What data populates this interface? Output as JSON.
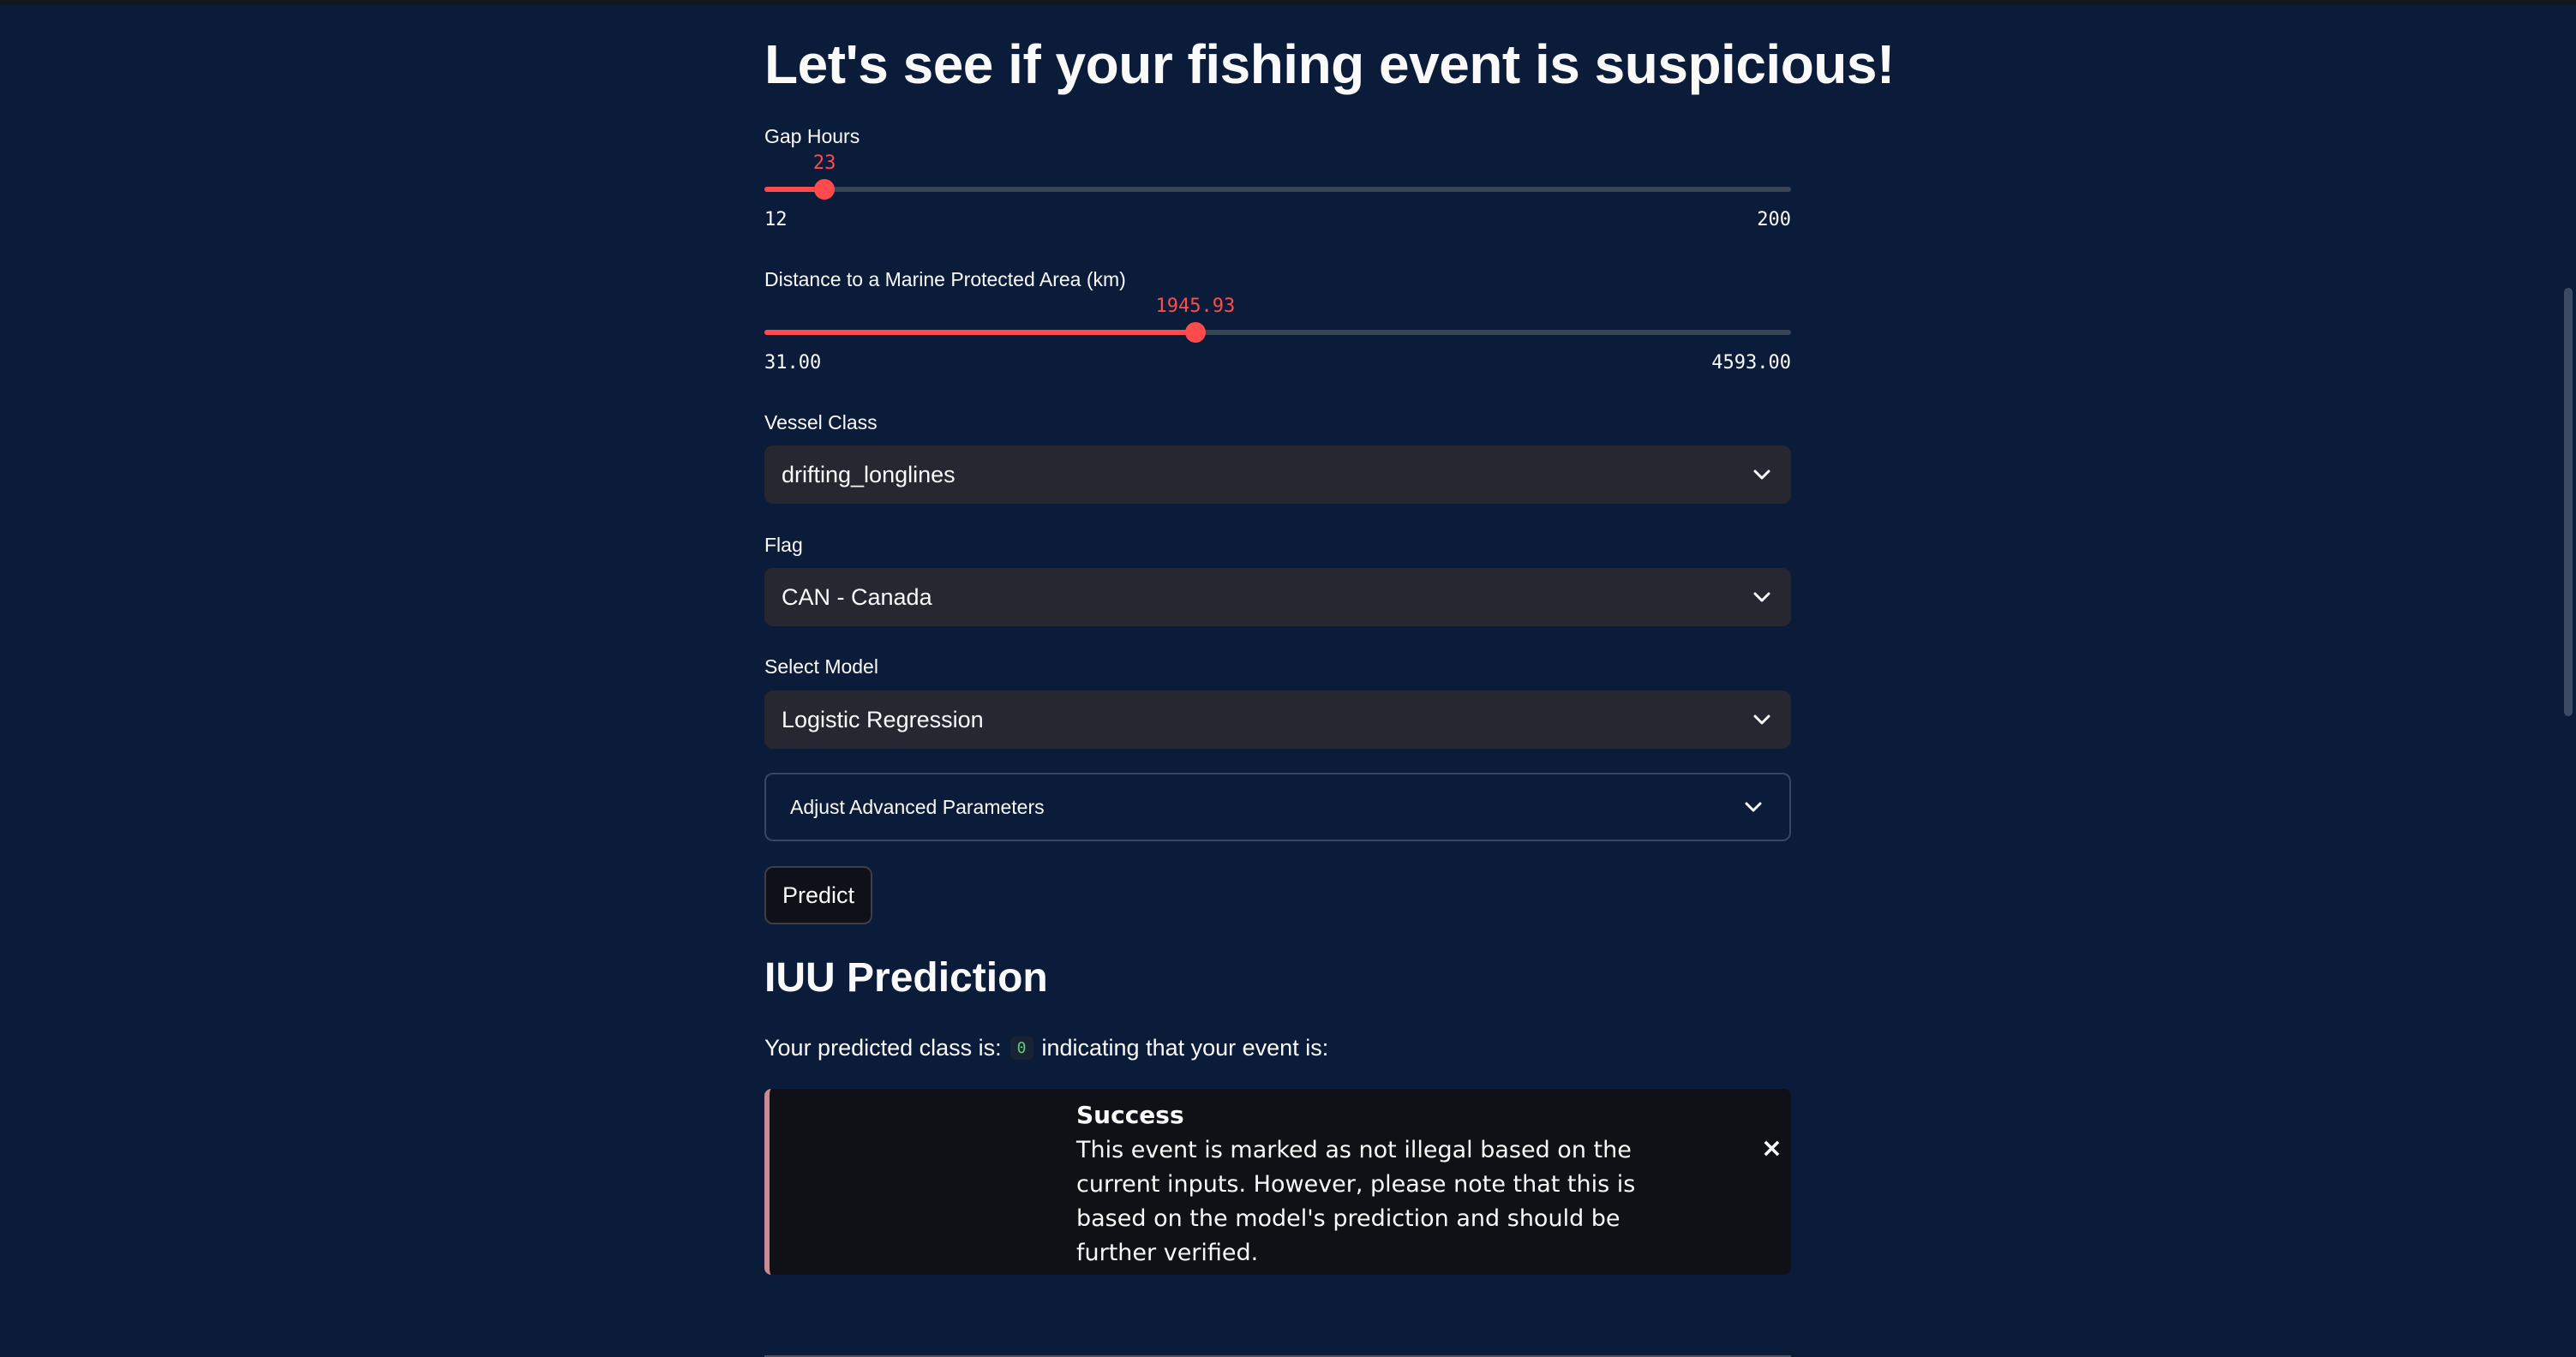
{
  "page": {
    "title": "Let's see if your fishing event is suspicious!"
  },
  "gap_hours": {
    "label": "Gap Hours",
    "value_text": "23",
    "value": 23,
    "min_text": "12",
    "max_text": "200",
    "min": 12,
    "max": 200
  },
  "distance_mpa": {
    "label": "Distance to a Marine Protected Area (km)",
    "value_text": "1945.93",
    "value": 1945.93,
    "min_text": "31.00",
    "max_text": "4593.00",
    "min": 31.0,
    "max": 4593.0
  },
  "vessel_class": {
    "label": "Vessel Class",
    "selected": "drifting_longlines"
  },
  "flag": {
    "label": "Flag",
    "selected": "CAN - Canada"
  },
  "model": {
    "label": "Select Model",
    "selected": "Logistic Regression"
  },
  "advanced": {
    "label": "Adjust Advanced Parameters"
  },
  "predict_button": {
    "label": "Predict"
  },
  "prediction": {
    "heading": "IUU Prediction",
    "prefix": "Your predicted class is:",
    "class_value": "0",
    "suffix": "indicating that your event is:"
  },
  "alert": {
    "title": "Success",
    "body": "This event is marked as not illegal based on the current inputs. However, please note that this is based on the model's prediction and should be further verified.",
    "close_glyph": "×"
  },
  "colors": {
    "background": "#0b1c3a",
    "accent": "#ff4b4b",
    "select_bg": "#262730",
    "alert_border": "#c98a93"
  },
  "icons": {
    "dropdown": "chevron-down-icon",
    "close": "close-icon"
  }
}
